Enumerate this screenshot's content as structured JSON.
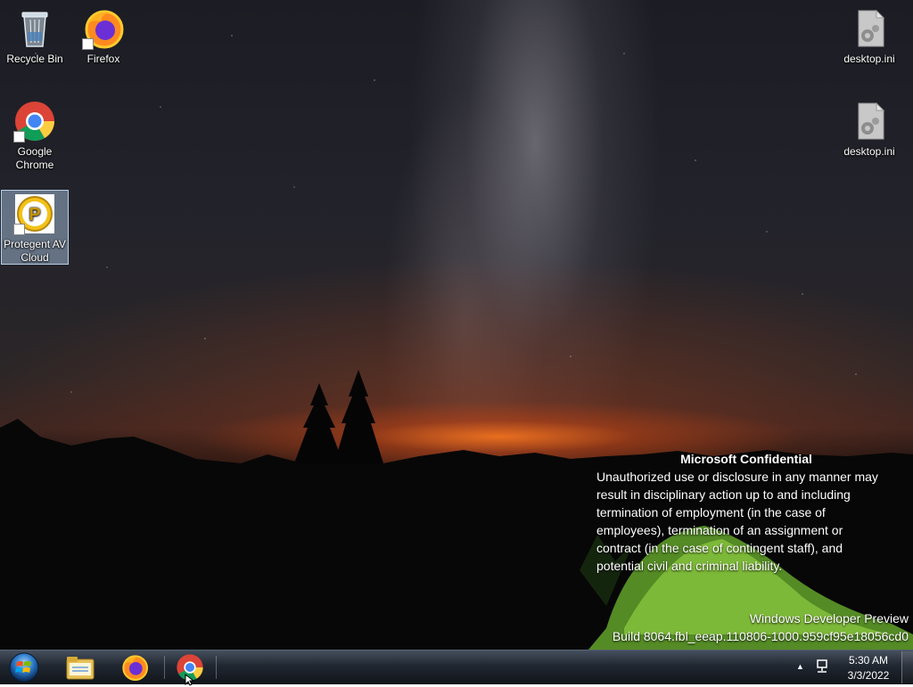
{
  "desktop": {
    "icons": [
      {
        "label": "Recycle Bin",
        "icon": "recycle-bin-icon"
      },
      {
        "label": "Firefox",
        "icon": "firefox-icon"
      },
      {
        "label": "Google Chrome",
        "icon": "chrome-icon"
      },
      {
        "label": "Protegent AV Cloud",
        "icon": "protegent-icon",
        "selected": true
      },
      {
        "label": "desktop.ini",
        "icon": "settings-file-icon"
      },
      {
        "label": "desktop.ini",
        "icon": "settings-file-icon"
      }
    ]
  },
  "notice": {
    "title": "Microsoft Confidential",
    "lines": [
      "Unauthorized use or disclosure in any manner may",
      "result in disciplinary action up to and including",
      "termination of employment (in the case of",
      "employees), termination of an assignment or",
      "contract (in the case of contingent staff), and",
      "potential civil and criminal liability."
    ]
  },
  "watermark": {
    "line1": "Windows Developer Preview",
    "line2": "Build 8064.fbl_eeap.110806-1000.959cf95e18056cd0"
  },
  "taskbar": {
    "start": {
      "icon": "windows-orb-icon"
    },
    "pinned": [
      {
        "name": "File Explorer",
        "icon": "file-explorer-icon"
      },
      {
        "name": "Firefox",
        "icon": "firefox-icon"
      },
      {
        "name": "Google Chrome",
        "icon": "chrome-icon"
      }
    ],
    "tray": {
      "overflow_icon": "chevron-up-icon",
      "network_icon": "network-icon"
    },
    "clock": {
      "time": "5:30 AM",
      "date": "3/3/2022"
    }
  },
  "colors": {
    "selection": "#b4d2f0",
    "taskbar": "#1a2029",
    "notice_text": "#ffffff"
  }
}
